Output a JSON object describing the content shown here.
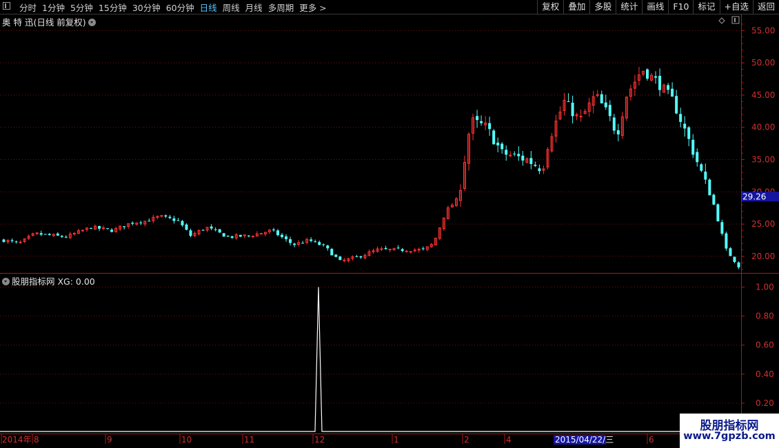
{
  "toolbar": {
    "periods": [
      "分时",
      "1分钟",
      "5分钟",
      "15分钟",
      "30分钟",
      "60分钟",
      "日线",
      "周线",
      "月线",
      "多周期",
      "更多 >"
    ],
    "active_period": "日线",
    "right_buttons": [
      "复权",
      "叠加",
      "多股",
      "统计",
      "画线",
      "F10",
      "标记",
      "+自选",
      "返回"
    ]
  },
  "main_panel": {
    "title": "奥 特 迅(日线 前复权)",
    "price_ticks": [
      "55.00",
      "50.00",
      "45.00",
      "40.00",
      "35.00",
      "30.00",
      "25.00",
      "20.00"
    ],
    "current_price": "29.26"
  },
  "indicator_panel": {
    "title": "股朋指标网  XG: 0.00",
    "ticks": [
      "1.00",
      "0.80",
      "0.60",
      "0.40",
      "0.20"
    ]
  },
  "time_axis": {
    "labels": [
      "2014年",
      "8",
      "9",
      "10",
      "11",
      "12",
      "1",
      "2",
      "4",
      "6"
    ],
    "cursor_date": "2015/04/22/三"
  },
  "watermark": {
    "line1": "股朋指标网",
    "line2": "www.7gpzb.com"
  },
  "colors": {
    "up": "#ff3232",
    "down": "#54ffff",
    "axis": "#b01818",
    "grid": "#7a1010",
    "active": "#59c3ff"
  },
  "chart_data": {
    "type": "candlestick",
    "price_range": [
      17,
      56
    ],
    "indicator_range": [
      0,
      1.05
    ],
    "closes_approx": [
      22.5,
      23.8,
      24.5,
      24.0,
      25.5,
      24.8,
      26.5,
      25.0,
      23.0,
      24.5,
      23.5,
      22.5,
      24.5,
      22.5,
      19.5,
      20.0,
      21.0,
      20.8,
      22.0,
      27.0,
      29.0,
      41.0,
      39.0,
      37.0,
      35.0,
      44.0,
      41.0,
      45.0,
      49.0,
      47.0,
      44.0,
      38.0,
      33.0,
      28.0,
      21.0,
      18.5
    ],
    "indicator_spike": {
      "position": "December 2014",
      "value": 1.0
    },
    "indicator_current": 0.0
  }
}
